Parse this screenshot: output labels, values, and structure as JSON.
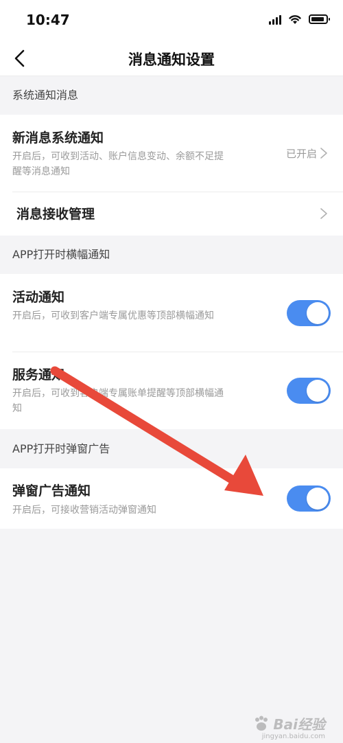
{
  "status_bar": {
    "time": "10:47"
  },
  "nav": {
    "title": "消息通知设置"
  },
  "sections": {
    "system": {
      "header": "系统通知消息",
      "new_message": {
        "title": "新消息系统通知",
        "desc": "开启后，可收到活动、账户信息变动、余额不足提醒等消息通知",
        "value": "已开启"
      },
      "receive_manage": {
        "title": "消息接收管理"
      }
    },
    "banner": {
      "header": "APP打开时横幅通知",
      "activity": {
        "title": "活动通知",
        "desc": "开启后，可收到客户端专属优惠等顶部横幅通知",
        "on": true
      },
      "service": {
        "title": "服务通知",
        "desc": "开启后，可收到客户端专属账单提醒等顶部横幅通知",
        "on": true
      }
    },
    "popup": {
      "header": "APP打开时弹窗广告",
      "popup_ad": {
        "title": "弹窗广告通知",
        "desc": "开启后，可接收营销活动弹窗通知",
        "on": true
      }
    }
  },
  "watermark": {
    "text": "Bai经验",
    "sub": "jingyan.baidu.com"
  },
  "colors": {
    "toggle_on": "#4a8cf0",
    "arrow": "#e8493a",
    "background": "#f4f4f6"
  }
}
